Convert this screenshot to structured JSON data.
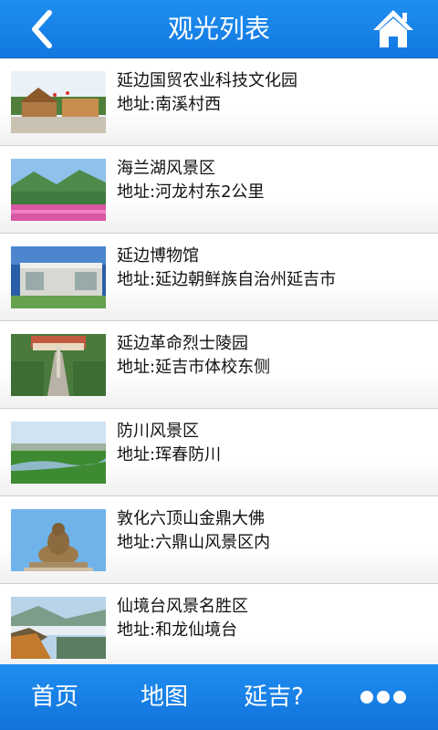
{
  "header": {
    "title": "观光列表"
  },
  "spots": [
    {
      "name": "延边国贸农业科技文化园",
      "address": "地址:南溪村西"
    },
    {
      "name": "海兰湖风景区",
      "address": "地址:河龙村东2公里"
    },
    {
      "name": "延边博物馆",
      "address": "地址:延边朝鲜族自治州延吉市"
    },
    {
      "name": "延边革命烈士陵园",
      "address": "地址:延吉市体校东侧"
    },
    {
      "name": "防川风景区",
      "address": "地址:珲春防川"
    },
    {
      "name": "敦化六顶山金鼎大佛",
      "address": "地址:六鼎山风景区内"
    },
    {
      "name": "仙境台风景名胜区",
      "address": "地址:和龙仙境台"
    }
  ],
  "footer": {
    "tabs": [
      "首页",
      "地图",
      "延吉?"
    ]
  },
  "colors": {
    "accent": "#1a86ec",
    "text": "#111111"
  },
  "icons": {
    "back": "chevron-left-icon",
    "home": "home-icon",
    "more": "more-dots-icon"
  }
}
